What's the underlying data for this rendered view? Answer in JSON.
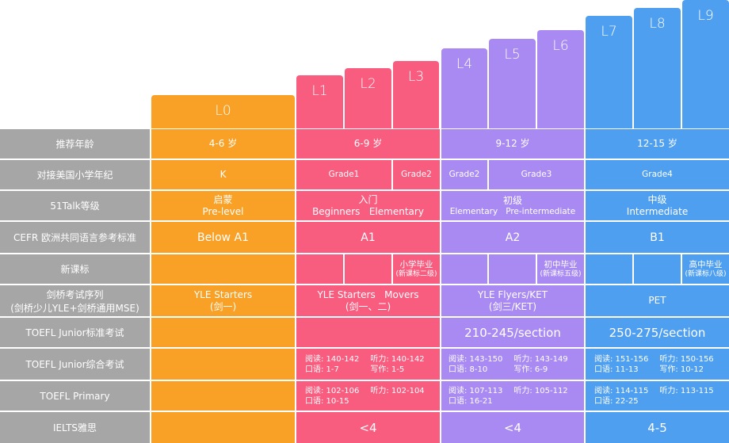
{
  "levels": [
    "L0",
    "L1",
    "L2",
    "L3",
    "L4",
    "L5",
    "L6",
    "L7",
    "L8",
    "L9"
  ],
  "row_headers": [
    "推荐年龄",
    "对接美国小学年纪",
    "51Talk等级",
    "CEFR 欧洲共同语言参考标准",
    "新课标",
    "剑桥考试序列",
    "(剑桥少儿YLE+剑桥通用MSE)",
    "TOEFL Junior标准考试",
    "TOEFL Junior综合考试",
    "TOEFL Primary",
    "IELTS雅思"
  ],
  "age": {
    "orange": "4-6 岁",
    "red": "6-9 岁",
    "purple": "9-12 岁",
    "blue": "12-15 岁"
  },
  "grade": {
    "orange": "K",
    "red1": "Grade1",
    "red2": "Grade2",
    "purple1": "Grade2",
    "purple2": "Grade3",
    "blue": "Grade4"
  },
  "talk": {
    "orange": {
      "cn": "启蒙",
      "en": "Pre-level"
    },
    "red": {
      "cn": "入门",
      "en": "Beginners   Elementary"
    },
    "purple": {
      "cn": "初级",
      "en": "Elementary   Pre-intermediate"
    },
    "blue": {
      "cn": "中级",
      "en": "Intermediate"
    }
  },
  "cefr": {
    "orange": "Below A1",
    "red": "A1",
    "purple": "A2",
    "blue": "B1"
  },
  "new_std": {
    "red": {
      "l1": "小学毕业",
      "l2": "(新课标二级)"
    },
    "purple": {
      "l1": "初中毕业",
      "l2": "(新课标五级)"
    },
    "blue": {
      "l1": "高中毕业",
      "l2": "(新课标八级)"
    }
  },
  "cambridge": {
    "orange": {
      "l1": "YLE Starters",
      "l2": "(剑一)"
    },
    "red": {
      "l1": "YLE Starters   Movers",
      "l2": "(剑一、二)"
    },
    "purple": {
      "l1": "YLE Flyers/KET",
      "l2": "(剑三/KET)"
    },
    "blue": {
      "l1": "PET"
    }
  },
  "toefl_std": {
    "purple": "210-245/section",
    "blue": "250-275/section"
  },
  "toefl_comp": {
    "red": [
      "阅读: 140-142",
      "听力: 140-142",
      "口语: 1-7",
      "写作: 1-5"
    ],
    "purple": [
      "阅读: 143-150",
      "听力: 143-149",
      "口语: 8-10",
      "写作: 6-9"
    ],
    "blue": [
      "阅读: 151-156",
      "听力: 150-156",
      "口语: 11-13",
      "写作: 10-12"
    ]
  },
  "toefl_primary": {
    "red": [
      "阅读: 102-106",
      "听力: 102-104",
      "口语: 10-15",
      ""
    ],
    "purple": [
      "阅读: 107-113",
      "听力: 105-112",
      "口语: 16-21",
      ""
    ],
    "blue": [
      "阅读: 114-115",
      "听力: 113-115",
      "口语: 22-25",
      ""
    ]
  },
  "ielts": {
    "red": "<4",
    "purple": "<4",
    "blue": "4-5"
  },
  "colors": {
    "orange": "#f8a126",
    "red": "#f85c7f",
    "purple": "#a88af2",
    "blue": "#4f9ff0",
    "header": "#a6a6a6"
  }
}
